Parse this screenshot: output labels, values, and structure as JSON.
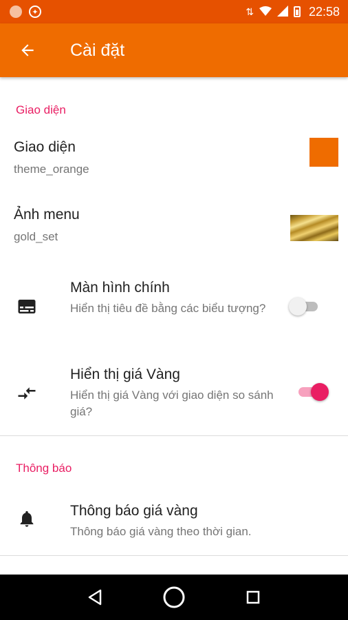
{
  "status_bar": {
    "time": "22:58"
  },
  "app_bar": {
    "title": "Cài đặt",
    "accent_color": "#ef6c00"
  },
  "sections": [
    {
      "header": "Giao diện",
      "items": [
        {
          "title": "Giao diện",
          "summary": "theme_orange",
          "widget": "color-swatch",
          "swatch_color": "#ef6c00"
        },
        {
          "title": "Ảnh menu",
          "summary": "gold_set",
          "widget": "image-thumbnail"
        },
        {
          "title": "Màn hình chính",
          "summary": "Hiển thị tiêu đề bằng các biểu tượng?",
          "icon": "subtitles-icon",
          "switch_on": false
        },
        {
          "title": "Hiển thị giá Vàng",
          "summary": "Hiển thị giá Vàng với giao diện so sánh giá?",
          "icon": "compare-arrows-icon",
          "switch_on": true
        }
      ]
    },
    {
      "header": "Thông báo",
      "items": [
        {
          "title": "Thông báo giá vàng",
          "summary": "Thông báo giá vàng theo thời gian.",
          "icon": "bell-icon"
        }
      ]
    }
  ],
  "colors": {
    "section_header": "#e91e63",
    "switch_on": "#e91e63",
    "status_bar": "#e65100"
  }
}
